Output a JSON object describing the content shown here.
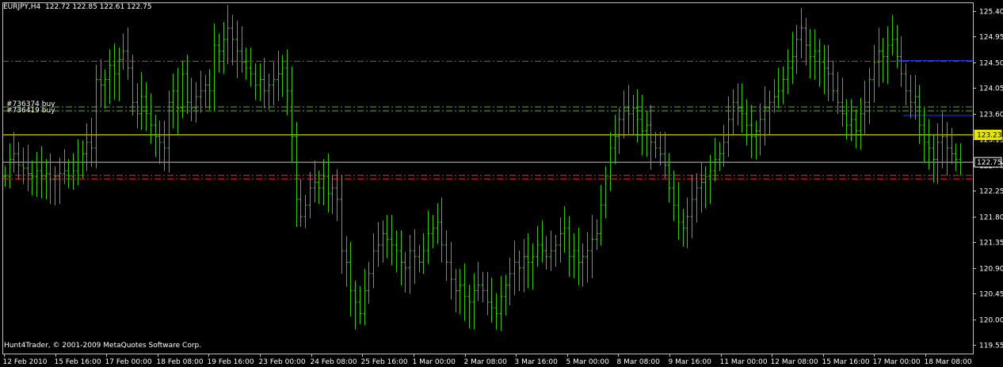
{
  "header": {
    "symbol": "EURJPY,H4",
    "ohlc": "122.72 122.85 122.61 122.75"
  },
  "footer": {
    "copyright": "Hunt4Trader, © 2001-2009 MetaQuotes Software Corp."
  },
  "orders": [
    {
      "label": "#736374 buy",
      "price": 123.72
    },
    {
      "label": "#736419 buy",
      "price": 123.65
    }
  ],
  "colors": {
    "background": "#000000",
    "bars": "#33cc00",
    "axis": "#c0c0c0",
    "resistance_support": "#ff2020",
    "order_lines": "#66aa33",
    "blue_lines": "#1f3cff",
    "bid_line": "#e6e600",
    "current_line": "#c8c8c8"
  },
  "chart_data": {
    "type": "ohlc",
    "title": "EURJPY,H4",
    "ylim": [
      119.4,
      125.55
    ],
    "y_ticks": [
      "125.40",
      "124.95",
      "124.50",
      "124.05",
      "123.60",
      "123.15",
      "122.70",
      "122.25",
      "121.80",
      "121.35",
      "120.90",
      "120.45",
      "120.00",
      "119.55"
    ],
    "x_ticks": [
      "12 Feb 2010",
      "15 Feb 16:00",
      "17 Feb 00:00",
      "18 Feb 08:00",
      "19 Feb 16:00",
      "23 Feb 00:00",
      "24 Feb 08:00",
      "25 Feb 16:00",
      "1 Mar 00:00",
      "2 Mar 08:00",
      "3 Mar 16:00",
      "5 Mar 00:00",
      "8 Mar 08:00",
      "9 Mar 16:00",
      "11 Mar 00:00",
      "12 Mar 08:00",
      "15 Mar 16:00",
      "17 Mar 00:00",
      "18 Mar 08:00"
    ],
    "horizontal_lines": [
      {
        "name": "resistance-red",
        "price": 124.52,
        "style": "dash-dot"
      },
      {
        "name": "support-red-1",
        "price": 122.52,
        "style": "dash-dot"
      },
      {
        "name": "support-red-2",
        "price": 122.46,
        "style": "dash-dot"
      },
      {
        "name": "bid-line",
        "price": 123.23,
        "style": "solid"
      },
      {
        "name": "current-price",
        "price": 122.75,
        "style": "solid"
      }
    ],
    "blue_segments": [
      {
        "price": 124.53
      },
      {
        "price": 123.57
      }
    ],
    "price_tags": [
      {
        "text": "123.23",
        "price": 123.23,
        "bg": "#e6e600",
        "fg": "#000000"
      },
      {
        "text": "122.75",
        "price": 122.75,
        "bg": "#000000",
        "fg": "#ffffff"
      }
    ],
    "close_path": [
      122.5,
      122.8,
      122.9,
      122.7,
      122.65,
      122.55,
      122.5,
      122.6,
      122.5,
      122.55,
      122.45,
      122.5,
      122.55,
      122.6,
      122.5,
      122.6,
      122.75,
      122.9,
      123.1,
      123.0,
      124.2,
      124.1,
      124.2,
      124.45,
      124.3,
      124.55,
      124.7,
      124.4,
      123.8,
      123.6,
      123.9,
      123.6,
      123.4,
      123.2,
      123.1,
      123.0,
      123.8,
      124.0,
      123.7,
      124.3,
      123.8,
      123.7,
      123.9,
      124.0,
      124.1,
      124.0,
      124.8,
      124.7,
      124.9,
      125.1,
      124.9,
      124.7,
      124.5,
      124.4,
      124.3,
      124.1,
      124.2,
      124.0,
      124.1,
      124.2,
      124.3,
      124.4,
      124.0,
      123.2,
      122.1,
      121.8,
      122.0,
      122.3,
      122.4,
      122.3,
      122.5,
      122.2,
      122.3,
      122.1,
      121.2,
      121.0,
      120.5,
      120.3,
      120.1,
      120.5,
      120.8,
      121.2,
      121.3,
      121.5,
      121.4,
      121.3,
      121.2,
      121.0,
      120.9,
      121.2,
      121.1,
      121.0,
      121.2,
      121.5,
      121.6,
      121.7,
      121.3,
      121.0,
      120.7,
      120.5,
      120.6,
      120.4,
      120.3,
      120.5,
      120.6,
      120.5,
      120.3,
      120.2,
      120.1,
      120.4,
      120.6,
      120.8,
      121.0,
      120.9,
      121.1,
      121.0,
      121.1,
      121.3,
      121.2,
      121.1,
      121.2,
      121.3,
      121.5,
      121.6,
      121.1,
      121.2,
      121.0,
      121.1,
      121.2,
      121.4,
      121.5,
      122.0,
      122.5,
      123.0,
      123.2,
      123.5,
      123.7,
      123.6,
      123.7,
      123.5,
      123.3,
      123.4,
      123.1,
      123.0,
      122.9,
      122.7,
      122.3,
      122.0,
      121.7,
      121.6,
      121.8,
      122.1,
      122.3,
      122.4,
      122.5,
      122.6,
      122.8,
      122.9,
      123.1,
      123.5,
      123.8,
      123.7,
      123.6,
      123.4,
      123.2,
      123.3,
      123.5,
      123.7,
      123.8,
      123.9,
      124.0,
      124.2,
      124.4,
      124.6,
      124.9,
      125.1,
      124.8,
      124.6,
      124.7,
      124.5,
      124.4,
      124.3,
      124.0,
      123.8,
      123.6,
      123.4,
      123.5,
      123.3,
      123.6,
      123.8,
      124.2,
      124.5,
      124.7,
      124.6,
      124.8,
      124.9,
      124.6,
      124.3,
      124.0,
      123.8,
      123.9,
      123.4,
      123.1,
      123.0,
      122.8,
      123.1,
      123.2,
      123.0,
      122.9,
      122.8,
      122.75
    ]
  }
}
